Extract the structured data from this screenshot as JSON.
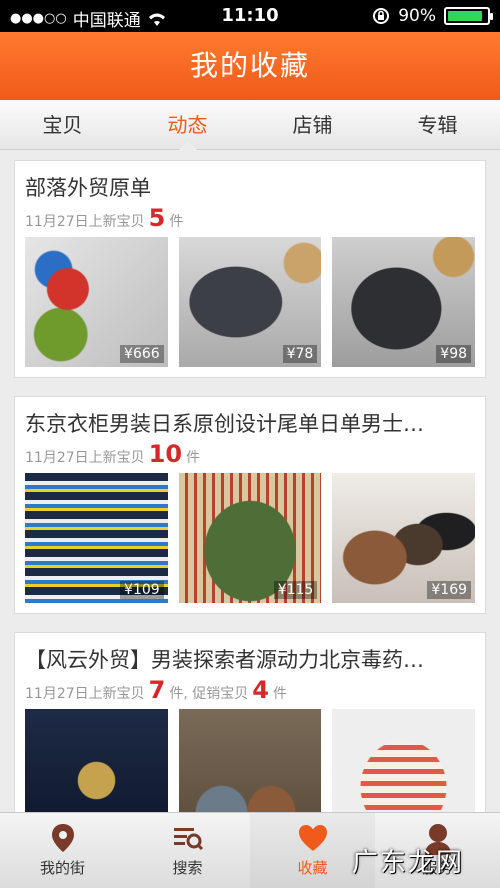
{
  "status_bar": {
    "carrier": "中国联通",
    "time": "11:10",
    "battery": "90%",
    "battery_level": 0.9
  },
  "header": {
    "title": "我的收藏"
  },
  "tabs": [
    {
      "label": "宝贝"
    },
    {
      "label": "动态"
    },
    {
      "label": "店铺"
    },
    {
      "label": "专辑"
    }
  ],
  "active_tab": 1,
  "cards": [
    {
      "name": "部落外贸原单",
      "date": "11月27日上新宝贝",
      "count": "5",
      "unit": "件",
      "promo_text": "",
      "promo_count": "",
      "promo_unit": "",
      "items": [
        {
          "price": "¥666",
          "image": "jackets"
        },
        {
          "price": "¥78",
          "image": "hoodie"
        },
        {
          "price": "¥98",
          "image": "leather-jacket"
        }
      ]
    },
    {
      "name": "东京衣柜男装日系原创设计尾单日单男士…",
      "date": "11月27日上新宝贝",
      "count": "10",
      "unit": "件",
      "promo_text": "",
      "promo_count": "",
      "promo_unit": "",
      "items": [
        {
          "price": "¥109",
          "image": "striped-sweater"
        },
        {
          "price": "¥115",
          "image": "green-sweater"
        },
        {
          "price": "¥169",
          "image": "snow-boots"
        }
      ]
    },
    {
      "name": "【风云外贸】男装探索者源动力北京毒药…",
      "date": "11月27日上新宝贝",
      "count": "7",
      "unit": "件, 促销宝贝",
      "promo_text": "",
      "promo_count": "4",
      "promo_unit": "件",
      "items": [
        {
          "price": "",
          "image": "polo-shirt"
        },
        {
          "price": "",
          "image": "sneakers"
        },
        {
          "price": "",
          "image": "striped-tshirt"
        }
      ]
    }
  ],
  "tabbar": [
    {
      "label": "我的街",
      "icon": "location-pin-icon"
    },
    {
      "label": "搜索",
      "icon": "search-list-icon"
    },
    {
      "label": "收藏",
      "icon": "heart-icon"
    },
    {
      "label": "服务",
      "icon": "person-icon"
    }
  ],
  "active_tabbar": 2,
  "watermark": "广东龙网",
  "colors": {
    "accent": "#f05a1a",
    "count": "#d4282a"
  }
}
